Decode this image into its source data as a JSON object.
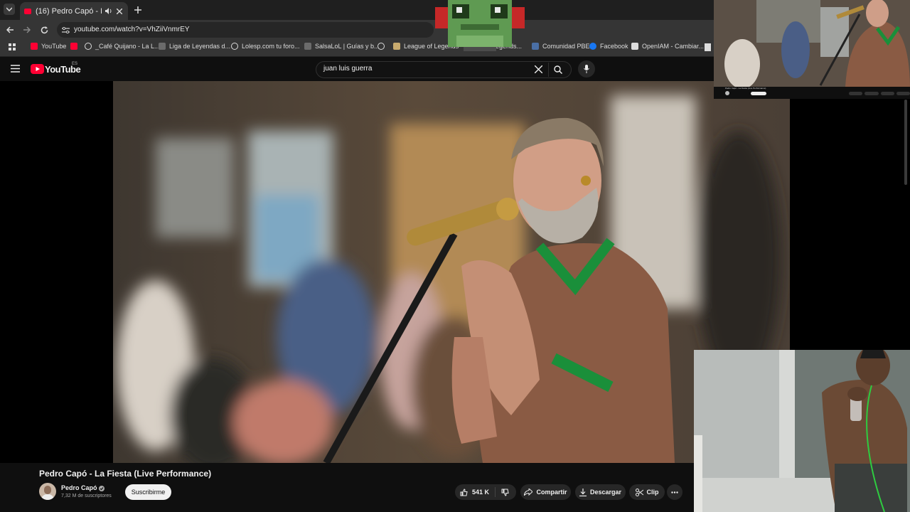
{
  "browser": {
    "tab_title": "(16) Pedro Capó - La Fiesta",
    "url": "youtube.com/watch?v=VhZiiVnmrEY",
    "bookmarks": [
      {
        "label": "YouTube",
        "color": "#ff0033"
      },
      {
        "label": "",
        "color": "#ff0033"
      },
      {
        "label": "_Café Quijano - La L...",
        "color": "#dddddd"
      },
      {
        "label": "Liga de Leyendas d...",
        "color": "#8a8a8a"
      },
      {
        "label": "Lolesp.com tu foro...",
        "color": "#dddddd"
      },
      {
        "label": "SalsaLoL | Guías y b...",
        "color": "#8a8a8a"
      },
      {
        "label": "",
        "color": "#dddddd"
      },
      {
        "label": "League of Legends",
        "color": "#c8aa6e"
      },
      {
        "label": "egends...",
        "color": "#c8aa6e"
      },
      {
        "label": "Comunidad PBE",
        "color": "#4a6fa5"
      },
      {
        "label": "Facebook",
        "color": "#1877f2"
      },
      {
        "label": "OpenIAM - Cambiar...",
        "color": "#dddddd"
      }
    ]
  },
  "youtube": {
    "logo_text": "YouTube",
    "region": "ES",
    "search_value": "juan luis guerra"
  },
  "video": {
    "title": "Pedro Capó - La Fiesta (Live Performance)",
    "channel": "Pedro Capó",
    "subscribers": "7,32 M de suscriptores",
    "subscribe_label": "Suscribirme",
    "likes": "541 K",
    "share_label": "Compartir",
    "download_label": "Descargar",
    "clip_label": "Clip"
  },
  "mini_overlay": {
    "title": "Pedro Capó - La Fiesta (Live Performance)"
  },
  "colors": {
    "accent": "#ff0033",
    "shirt": "#8a5b44",
    "collar": "#1a8f3a"
  }
}
